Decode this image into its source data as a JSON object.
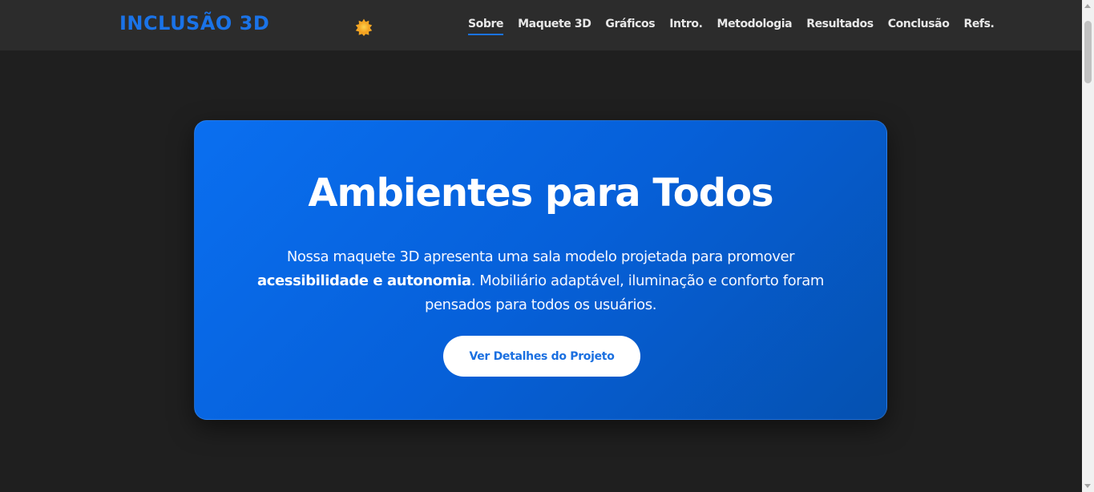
{
  "header": {
    "logo": "INCLUSÃO 3D",
    "theme_toggle_icon": "sun-icon",
    "nav": [
      {
        "label": "Sobre",
        "active": true
      },
      {
        "label": "Maquete 3D",
        "active": false
      },
      {
        "label": "Gráficos",
        "active": false
      },
      {
        "label": "Intro.",
        "active": false
      },
      {
        "label": "Metodologia",
        "active": false
      },
      {
        "label": "Resultados",
        "active": false
      },
      {
        "label": "Conclusão",
        "active": false
      },
      {
        "label": "Refs.",
        "active": false
      }
    ]
  },
  "hero": {
    "title": "Ambientes para Todos",
    "text_before": "Nossa maquete 3D apresenta uma sala modelo projetada para promover ",
    "text_bold": "acessibilidade e autonomia",
    "text_after": ". Mobiliário adaptável, iluminação e conforto foram pensados para todos os usuários.",
    "button_label": "Ver Detalhes do Projeto"
  },
  "colors": {
    "accent": "#1a73e8",
    "background": "#1f1f1f",
    "navbar": "#2c2c2c",
    "hero_gradient_start": "#0a6ff0",
    "hero_gradient_end": "#0551b0"
  }
}
